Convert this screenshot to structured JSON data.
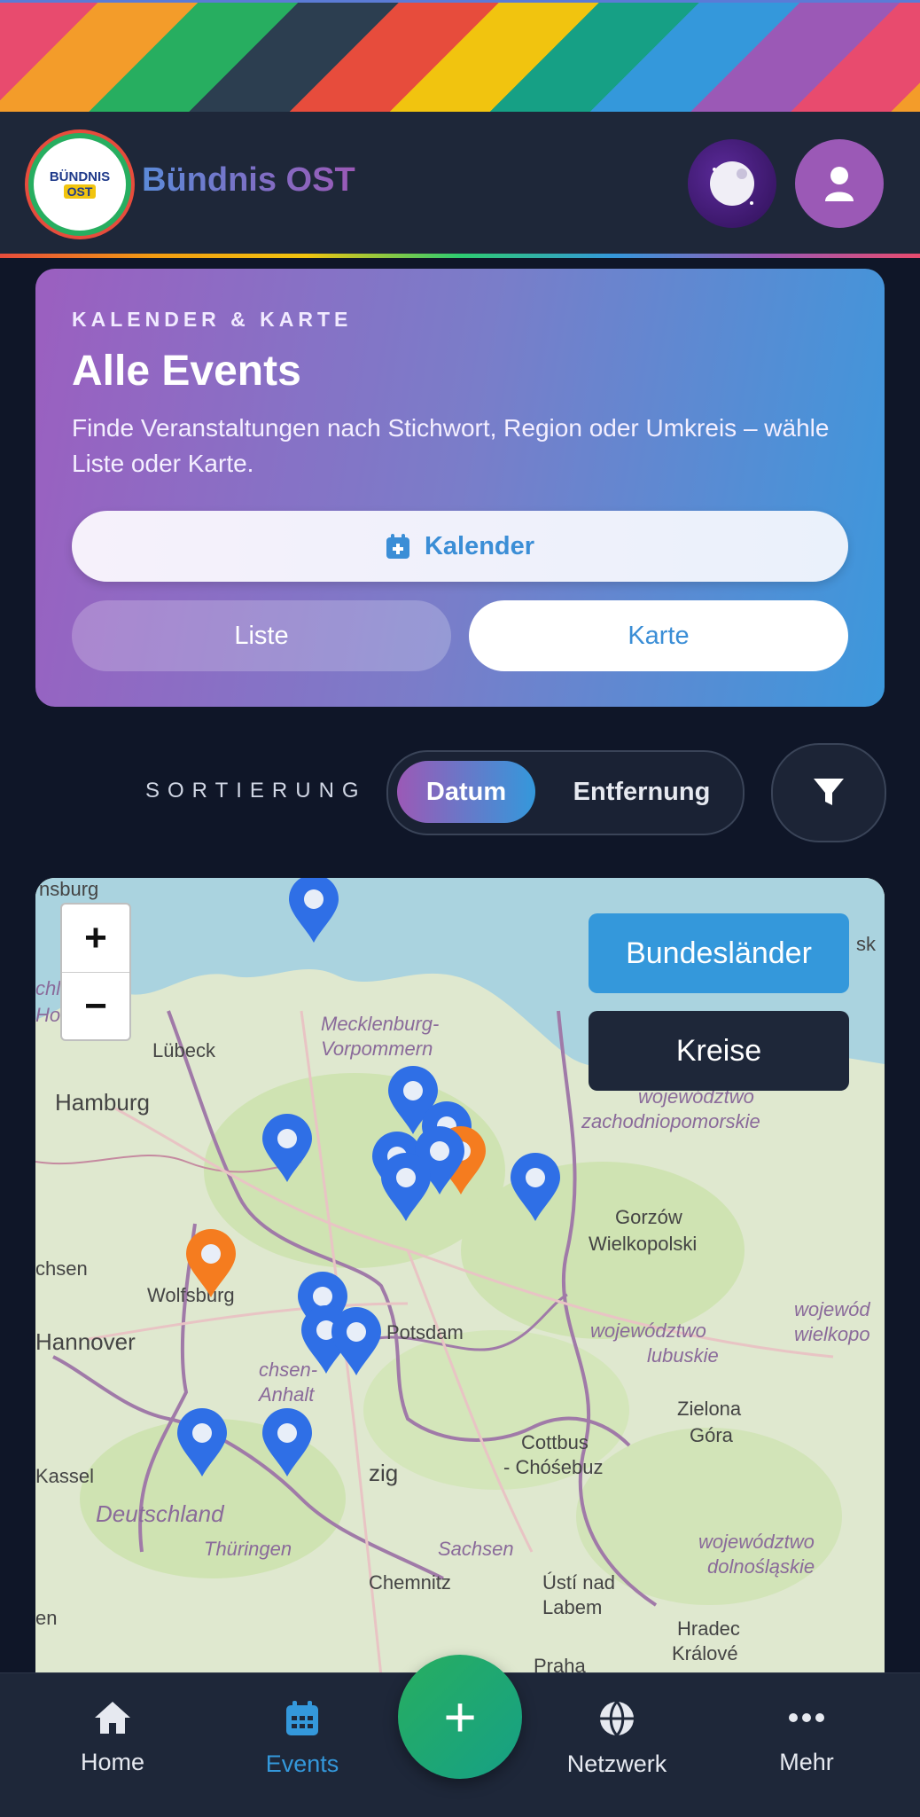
{
  "header": {
    "brand": "Bündnis OST",
    "logo_line1": "BÜNDNIS",
    "logo_line2": "OST",
    "theme_icon": "moon-icon",
    "user_icon": "user-icon"
  },
  "hero": {
    "kicker": "KALENDER & KARTE",
    "title": "Alle Events",
    "description": "Finde Veranstaltungen nach Stichwort, Region oder Umkreis – wähle Liste oder Karte.",
    "calendar_label": "Kalender",
    "list_label": "Liste",
    "map_label": "Karte"
  },
  "sort": {
    "label": "SORTIERUNG",
    "date_label": "Datum",
    "distance_label": "Entfernung",
    "selected": "Datum",
    "filter_icon": "filter-icon"
  },
  "map": {
    "zoom_in": "+",
    "zoom_out": "−",
    "layer_states": "Bundesländer",
    "layer_districts": "Kreise",
    "labels": {
      "hamburg": "Hamburg",
      "luebeck": "Lübeck",
      "mv1": "Mecklenburg-",
      "mv2": "Vorpommern",
      "zach1": "województwo",
      "zach2": "zachodniopomorskie",
      "gorzow1": "Gorzów",
      "gorzow2": "Wielkopolski",
      "wolfsburg": "Wolfsburg",
      "hannover": "Hannover",
      "potsdam": "Potsdam",
      "lub1": "województwo",
      "lub2": "lubuskie",
      "wiel1": "wojewód",
      "wiel2": "wielkopo",
      "zielona1": "Zielona",
      "zielona2": "Góra",
      "sachsen_anhalt1": "chsen-",
      "sachsen_anhalt2": "Anhalt",
      "cottbus1": "Cottbus",
      "cottbus2": "- Chóśebuz",
      "leipzig": "zig",
      "kassel": "Kassel",
      "deutschland": "Deutschland",
      "thueringen": "Thüringen",
      "sachsen": "Sachsen",
      "chemnitz": "Chemnitz",
      "usti1": "Ústí nad",
      "usti2": "Labem",
      "dolno1": "województwo",
      "dolno2": "dolnośląskie",
      "hradec1": "Hradec",
      "hradec2": "Králové",
      "praha": "Praha",
      "insburg": "nsburg",
      "ssk": "sk",
      "chs": "chsen",
      "en": "en",
      "chl": "chl",
      "ho": "Ho"
    },
    "pin_colors": {
      "blue": "#2f6fe6",
      "orange": "#f57c1f"
    }
  },
  "nav": {
    "home": "Home",
    "events": "Events",
    "network": "Netzwerk",
    "more": "Mehr",
    "add": "+",
    "active": "Events"
  }
}
